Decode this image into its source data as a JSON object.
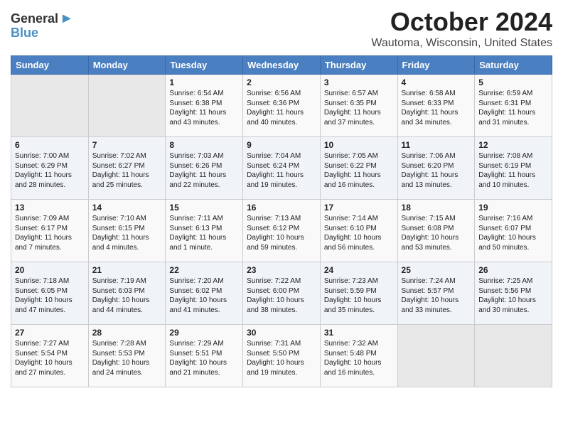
{
  "header": {
    "logo_line1a": "General",
    "logo_line1b": "Blue",
    "month": "October 2024",
    "location": "Wautoma, Wisconsin, United States"
  },
  "weekdays": [
    "Sunday",
    "Monday",
    "Tuesday",
    "Wednesday",
    "Thursday",
    "Friday",
    "Saturday"
  ],
  "weeks": [
    [
      {
        "day": "",
        "sunrise": "",
        "sunset": "",
        "daylight": ""
      },
      {
        "day": "",
        "sunrise": "",
        "sunset": "",
        "daylight": ""
      },
      {
        "day": "1",
        "sunrise": "Sunrise: 6:54 AM",
        "sunset": "Sunset: 6:38 PM",
        "daylight": "Daylight: 11 hours and 43 minutes."
      },
      {
        "day": "2",
        "sunrise": "Sunrise: 6:56 AM",
        "sunset": "Sunset: 6:36 PM",
        "daylight": "Daylight: 11 hours and 40 minutes."
      },
      {
        "day": "3",
        "sunrise": "Sunrise: 6:57 AM",
        "sunset": "Sunset: 6:35 PM",
        "daylight": "Daylight: 11 hours and 37 minutes."
      },
      {
        "day": "4",
        "sunrise": "Sunrise: 6:58 AM",
        "sunset": "Sunset: 6:33 PM",
        "daylight": "Daylight: 11 hours and 34 minutes."
      },
      {
        "day": "5",
        "sunrise": "Sunrise: 6:59 AM",
        "sunset": "Sunset: 6:31 PM",
        "daylight": "Daylight: 11 hours and 31 minutes."
      }
    ],
    [
      {
        "day": "6",
        "sunrise": "Sunrise: 7:00 AM",
        "sunset": "Sunset: 6:29 PM",
        "daylight": "Daylight: 11 hours and 28 minutes."
      },
      {
        "day": "7",
        "sunrise": "Sunrise: 7:02 AM",
        "sunset": "Sunset: 6:27 PM",
        "daylight": "Daylight: 11 hours and 25 minutes."
      },
      {
        "day": "8",
        "sunrise": "Sunrise: 7:03 AM",
        "sunset": "Sunset: 6:26 PM",
        "daylight": "Daylight: 11 hours and 22 minutes."
      },
      {
        "day": "9",
        "sunrise": "Sunrise: 7:04 AM",
        "sunset": "Sunset: 6:24 PM",
        "daylight": "Daylight: 11 hours and 19 minutes."
      },
      {
        "day": "10",
        "sunrise": "Sunrise: 7:05 AM",
        "sunset": "Sunset: 6:22 PM",
        "daylight": "Daylight: 11 hours and 16 minutes."
      },
      {
        "day": "11",
        "sunrise": "Sunrise: 7:06 AM",
        "sunset": "Sunset: 6:20 PM",
        "daylight": "Daylight: 11 hours and 13 minutes."
      },
      {
        "day": "12",
        "sunrise": "Sunrise: 7:08 AM",
        "sunset": "Sunset: 6:19 PM",
        "daylight": "Daylight: 11 hours and 10 minutes."
      }
    ],
    [
      {
        "day": "13",
        "sunrise": "Sunrise: 7:09 AM",
        "sunset": "Sunset: 6:17 PM",
        "daylight": "Daylight: 11 hours and 7 minutes."
      },
      {
        "day": "14",
        "sunrise": "Sunrise: 7:10 AM",
        "sunset": "Sunset: 6:15 PM",
        "daylight": "Daylight: 11 hours and 4 minutes."
      },
      {
        "day": "15",
        "sunrise": "Sunrise: 7:11 AM",
        "sunset": "Sunset: 6:13 PM",
        "daylight": "Daylight: 11 hours and 1 minute."
      },
      {
        "day": "16",
        "sunrise": "Sunrise: 7:13 AM",
        "sunset": "Sunset: 6:12 PM",
        "daylight": "Daylight: 10 hours and 59 minutes."
      },
      {
        "day": "17",
        "sunrise": "Sunrise: 7:14 AM",
        "sunset": "Sunset: 6:10 PM",
        "daylight": "Daylight: 10 hours and 56 minutes."
      },
      {
        "day": "18",
        "sunrise": "Sunrise: 7:15 AM",
        "sunset": "Sunset: 6:08 PM",
        "daylight": "Daylight: 10 hours and 53 minutes."
      },
      {
        "day": "19",
        "sunrise": "Sunrise: 7:16 AM",
        "sunset": "Sunset: 6:07 PM",
        "daylight": "Daylight: 10 hours and 50 minutes."
      }
    ],
    [
      {
        "day": "20",
        "sunrise": "Sunrise: 7:18 AM",
        "sunset": "Sunset: 6:05 PM",
        "daylight": "Daylight: 10 hours and 47 minutes."
      },
      {
        "day": "21",
        "sunrise": "Sunrise: 7:19 AM",
        "sunset": "Sunset: 6:03 PM",
        "daylight": "Daylight: 10 hours and 44 minutes."
      },
      {
        "day": "22",
        "sunrise": "Sunrise: 7:20 AM",
        "sunset": "Sunset: 6:02 PM",
        "daylight": "Daylight: 10 hours and 41 minutes."
      },
      {
        "day": "23",
        "sunrise": "Sunrise: 7:22 AM",
        "sunset": "Sunset: 6:00 PM",
        "daylight": "Daylight: 10 hours and 38 minutes."
      },
      {
        "day": "24",
        "sunrise": "Sunrise: 7:23 AM",
        "sunset": "Sunset: 5:59 PM",
        "daylight": "Daylight: 10 hours and 35 minutes."
      },
      {
        "day": "25",
        "sunrise": "Sunrise: 7:24 AM",
        "sunset": "Sunset: 5:57 PM",
        "daylight": "Daylight: 10 hours and 33 minutes."
      },
      {
        "day": "26",
        "sunrise": "Sunrise: 7:25 AM",
        "sunset": "Sunset: 5:56 PM",
        "daylight": "Daylight: 10 hours and 30 minutes."
      }
    ],
    [
      {
        "day": "27",
        "sunrise": "Sunrise: 7:27 AM",
        "sunset": "Sunset: 5:54 PM",
        "daylight": "Daylight: 10 hours and 27 minutes."
      },
      {
        "day": "28",
        "sunrise": "Sunrise: 7:28 AM",
        "sunset": "Sunset: 5:53 PM",
        "daylight": "Daylight: 10 hours and 24 minutes."
      },
      {
        "day": "29",
        "sunrise": "Sunrise: 7:29 AM",
        "sunset": "Sunset: 5:51 PM",
        "daylight": "Daylight: 10 hours and 21 minutes."
      },
      {
        "day": "30",
        "sunrise": "Sunrise: 7:31 AM",
        "sunset": "Sunset: 5:50 PM",
        "daylight": "Daylight: 10 hours and 19 minutes."
      },
      {
        "day": "31",
        "sunrise": "Sunrise: 7:32 AM",
        "sunset": "Sunset: 5:48 PM",
        "daylight": "Daylight: 10 hours and 16 minutes."
      },
      {
        "day": "",
        "sunrise": "",
        "sunset": "",
        "daylight": ""
      },
      {
        "day": "",
        "sunrise": "",
        "sunset": "",
        "daylight": ""
      }
    ]
  ]
}
